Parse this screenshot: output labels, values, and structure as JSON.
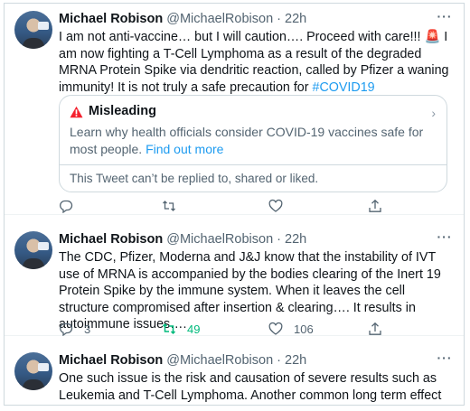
{
  "tweets": [
    {
      "name": "Michael Robison",
      "handle": "@MichaelRobison",
      "dot": "·",
      "time": "22h",
      "text": "I am not anti-vaccine… but I will caution…. Proceed with care!!! 🚨 I am now fighting a T-Cell Lymphoma as a result of the degraded MRNA Protein Spike via dendritic reaction, called by Pfizer a waning immunity! It is not truly a safe precaution for ",
      "hashtag": "#COVID19",
      "notice": {
        "title": "Misleading",
        "description": "Learn why health officials consider COVID-19 vaccines safe for most people.",
        "link": "Find out more",
        "note": "This Tweet can’t be replied to, shared or liked."
      },
      "actions": {
        "replies": "",
        "retweets": "",
        "likes": ""
      }
    },
    {
      "name": "Michael Robison",
      "handle": "@MichaelRobison",
      "dot": "·",
      "time": "22h",
      "text": "The CDC, Pfizer, Moderna and J&J know that the instability of IVT use of MRNA is accompanied by the bodies clearing of the Inert 19 Protein Spike by the immune system. When it leaves the cell structure compromised after insertion & clearing…. It results in autoimmune issues….",
      "actions": {
        "replies": "3",
        "retweets": "49",
        "likes": "106"
      }
    },
    {
      "name": "Michael Robison",
      "handle": "@MichaelRobison",
      "dot": "·",
      "time": "22h",
      "text": "One such issue is the risk and causation of severe results such as Leukemia and T-Cell Lymphoma. Another common long term effect is autoimmune"
    }
  ],
  "colors": {
    "link": "#1d9bf0",
    "muted": "#536471",
    "retweet_active": "#00ba7c",
    "warning": "#f4212e"
  },
  "icons": [
    "more-icon",
    "warning-icon",
    "chevron-right-icon",
    "reply-icon",
    "retweet-icon",
    "like-icon",
    "share-icon"
  ]
}
